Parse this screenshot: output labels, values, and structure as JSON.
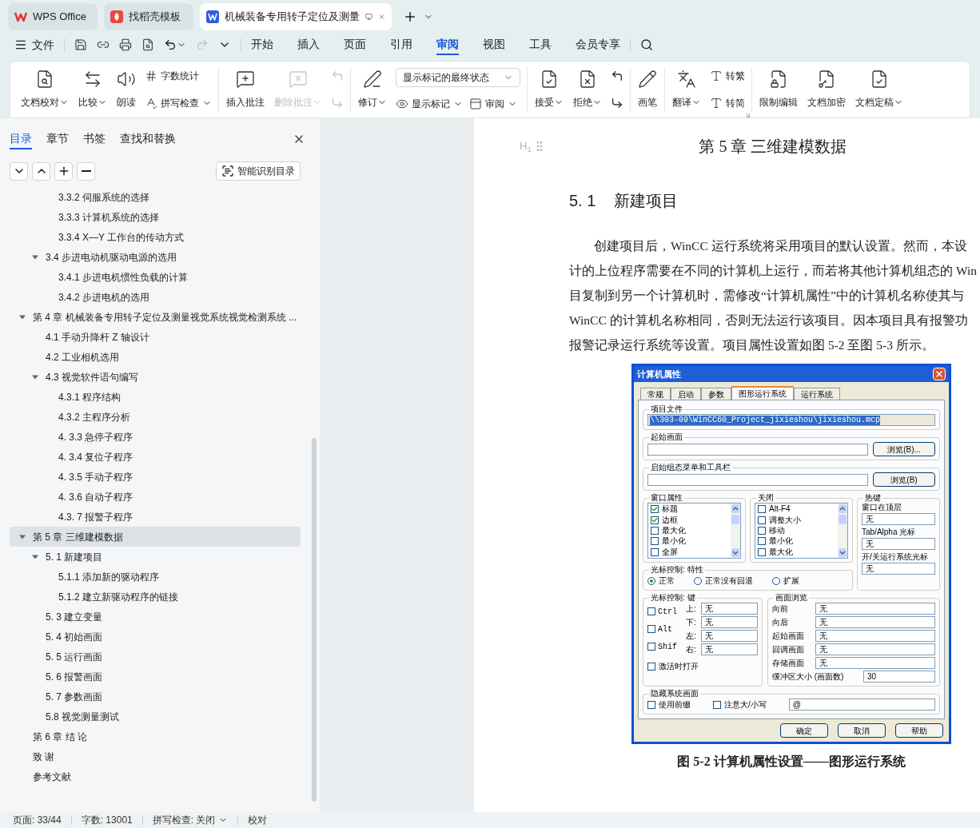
{
  "browser_tabs": [
    {
      "label": "WPS Office",
      "selected": false
    },
    {
      "label": "找稻壳模板",
      "selected": false
    },
    {
      "label": "机械装备专用转子定位及测量",
      "selected": true
    }
  ],
  "menu": {
    "file": "文件",
    "tabs": [
      {
        "label": "开始",
        "selected": false
      },
      {
        "label": "插入",
        "selected": false
      },
      {
        "label": "页面",
        "selected": false
      },
      {
        "label": "引用",
        "selected": false
      },
      {
        "label": "审阅",
        "selected": true
      },
      {
        "label": "视图",
        "selected": false
      },
      {
        "label": "工具",
        "selected": false
      },
      {
        "label": "会员专享",
        "selected": false
      }
    ]
  },
  "ribbon": {
    "groups": [
      {
        "items": [
          {
            "kind": "large",
            "label": "文档校对",
            "caret": true,
            "disabled": false
          },
          {
            "kind": "large",
            "label": "比较",
            "caret": true,
            "disabled": false
          },
          {
            "kind": "large",
            "label": "朗读",
            "caret": false,
            "disabled": false
          },
          {
            "kind": "stack",
            "rows": [
              {
                "label": "字数统计",
                "caret": false
              },
              {
                "label": "拼写检查",
                "caret": true
              }
            ]
          }
        ]
      },
      {
        "items": [
          {
            "kind": "large",
            "label": "插入批注",
            "caret": false,
            "disabled": false
          },
          {
            "kind": "large",
            "label": "删除批注",
            "caret": true,
            "disabled": true
          },
          {
            "kind": "icons",
            "disabled": true
          }
        ]
      },
      {
        "items": [
          {
            "kind": "large",
            "label": "修订",
            "caret": true,
            "disabled": false
          },
          {
            "kind": "select",
            "value": "显示标记的最终状态",
            "rows": [
              {
                "label": "显示标记",
                "caret": true
              },
              {
                "label": "审阅",
                "caret": true
              }
            ]
          }
        ]
      },
      {
        "items": [
          {
            "kind": "large",
            "label": "接受",
            "caret": true,
            "disabled": false
          },
          {
            "kind": "large",
            "label": "拒绝",
            "caret": true,
            "disabled": false
          },
          {
            "kind": "icons",
            "disabled": false
          }
        ]
      },
      {
        "items": [
          {
            "kind": "large",
            "label": "画笔",
            "caret": false,
            "disabled": false
          }
        ]
      },
      {
        "launcher": true,
        "items": [
          {
            "kind": "large",
            "label": "翻译",
            "caret": true,
            "disabled": false
          },
          {
            "kind": "stack",
            "rows": [
              {
                "label": "转繁",
                "caret": false
              },
              {
                "label": "转简",
                "caret": false
              }
            ]
          }
        ]
      },
      {
        "items": [
          {
            "kind": "large",
            "label": "限制编辑",
            "caret": false,
            "disabled": false
          },
          {
            "kind": "large",
            "label": "文档加密",
            "caret": false,
            "disabled": false
          },
          {
            "kind": "large",
            "label": "文档定稿",
            "caret": true,
            "disabled": false
          }
        ]
      }
    ]
  },
  "nav": {
    "tabs": [
      {
        "label": "目录",
        "selected": true
      },
      {
        "label": "章节",
        "selected": false
      },
      {
        "label": "书签",
        "selected": false
      },
      {
        "label": "查找和替换",
        "selected": false
      }
    ],
    "smart_toc_button": "智能识别目录",
    "toc": [
      {
        "children": [
          {
            "children": [
              {
                "label": "3.3.2 伺服系统的选择",
                "selected": false
              },
              {
                "label": "3.3.3 计算机系统的选择",
                "selected": false
              },
              {
                "label": "3.3.4 X—Y 工作台的传动方式",
                "selected": false
              }
            ]
          },
          {
            "label": "3.4 步进电动机驱动电源的选用",
            "selected": false,
            "expanded": true,
            "children": [
              {
                "label": "3.4.1 步进电机惯性负载的计算",
                "selected": false
              },
              {
                "label": "3.4.2 步进电机的选用",
                "selected": false
              }
            ]
          }
        ]
      },
      {
        "label": "第 4 章  机械装备专用转子定位及测量视觉系统视觉检测系统 ...",
        "selected": false,
        "expanded": true,
        "children": [
          {
            "label": "4.1  手动升降杆 Z 轴设计",
            "selected": false
          },
          {
            "label": "4.2  工业相机选用",
            "selected": false
          },
          {
            "label": "4.3  视觉软件语句编写",
            "selected": false,
            "expanded": true,
            "children": [
              {
                "label": "4.3.1  程序结构",
                "selected": false
              },
              {
                "label": "4.3.2  主程序分析",
                "selected": false
              },
              {
                "label": "4. 3.3  急停子程序",
                "selected": false
              },
              {
                "label": "4. 3.4  复位子程序",
                "selected": false
              },
              {
                "label": "4. 3.5  手动子程序",
                "selected": false
              },
              {
                "label": "4. 3.6  自动子程序",
                "selected": false
              },
              {
                "label": "4.3. 7  报警子程序",
                "selected": false
              }
            ]
          }
        ]
      },
      {
        "label": "第 5 章  三维建模数据",
        "selected": true,
        "expanded": true,
        "children": [
          {
            "label": "5. 1    新建项目",
            "selected": false,
            "expanded": true,
            "children": [
              {
                "label": "5.1.1  添加新的驱动程序",
                "selected": false
              },
              {
                "label": "5.1.2   建立新驱动程序的链接",
                "selected": false
              }
            ]
          },
          {
            "label": "5. 3     建立变量",
            "selected": false
          },
          {
            "label": "5. 4     初始画面",
            "selected": false
          },
          {
            "label": "5. 5     运行画面",
            "selected": false
          },
          {
            "label": "5. 6     报警画面",
            "selected": false
          },
          {
            "label": "5. 7     参数画面",
            "selected": false
          },
          {
            "label": "5.8     视觉测量测试",
            "selected": false
          }
        ]
      },
      {
        "label": "第 6 章  结     论",
        "selected": false
      },
      {
        "label": "致     谢",
        "selected": false
      },
      {
        "label": "参考文献",
        "selected": false
      }
    ]
  },
  "document": {
    "heading_marker": "H$_{1}$",
    "chapter_title": "第 5 章  三维建模数据",
    "section_title": "5. 1    新建项目",
    "paragraph_lines": [
      "创建项目后，WinCC 运行系统将采用项目的默认设置。然而，本设",
      "计的上位程序需要在不同的计算机上运行，而若将其他计算机组态的 Win",
      "目复制到另一个计算机时，需修改“计算机属性”中的计算机名称使其与",
      "WinCC 的计算机名称相同，否则无法运行该项目。因本项目具有报警功",
      "报警记录运行系统等设置。项目属性设置如图 5-2 至图 5-3 所示。"
    ],
    "dialog": {
      "title": "计算机属性",
      "tabs": [
        {
          "label": "常规",
          "selected": false
        },
        {
          "label": "启动",
          "selected": false
        },
        {
          "label": "参数",
          "selected": false
        },
        {
          "label": "图形运行系统",
          "selected": true
        },
        {
          "label": "运行系统",
          "selected": false
        }
      ],
      "project_file": {
        "label": "项目文件",
        "value": "\\\\303-09\\WinCC60_Project_jixieshou\\jixieshou.mcp"
      },
      "start_picture": {
        "label": "起始画面",
        "button": "浏览(B)..."
      },
      "start_menu": {
        "label": "启始组态菜单和工具栏",
        "button": "浏览(B)"
      },
      "window_attributes": {
        "label": "窗口属性",
        "items": [
          {
            "label": "标题",
            "checked": true
          },
          {
            "label": "边框",
            "checked": true
          },
          {
            "label": "最大化",
            "checked": false
          },
          {
            "label": "最小化",
            "checked": false
          },
          {
            "label": "全屏",
            "checked": false
          }
        ]
      },
      "close": {
        "label": "关闭",
        "items": [
          {
            "label": "Alt-F4",
            "checked": false
          },
          {
            "label": "调整大小",
            "checked": false
          },
          {
            "label": "移动",
            "checked": false
          },
          {
            "label": "最小化",
            "checked": false
          },
          {
            "label": "最大化",
            "checked": false
          }
        ]
      },
      "hotkeys": {
        "label": "热键",
        "fields": [
          {
            "label": "窗口在顶层",
            "value": "无"
          },
          {
            "label": "Tab/Alpha 光标",
            "value": "无"
          },
          {
            "label": "开/关运行系统光标",
            "value": "无"
          }
        ]
      },
      "cursor_mode": {
        "label": "光标控制: 特性",
        "options": [
          {
            "label": "正常",
            "selected": true
          },
          {
            "label": "正常没有回退",
            "selected": false
          },
          {
            "label": "扩展",
            "selected": false
          }
        ]
      },
      "cursor_keys": {
        "label": "光标控制: 键",
        "modifiers": [
          {
            "label": "Ctrl",
            "checked": false
          },
          {
            "label": "Alt",
            "checked": false
          },
          {
            "label": "Shif",
            "checked": false
          }
        ],
        "directions": [
          {
            "label": "上:",
            "value": "无"
          },
          {
            "label": "下:",
            "value": "无"
          },
          {
            "label": "左:",
            "value": "无"
          },
          {
            "label": "右:",
            "value": "无"
          }
        ],
        "activate": {
          "label": "激活时打开",
          "checked": false
        }
      },
      "picture_navigation": {
        "label": "画面浏览",
        "fields": [
          {
            "label": "向前",
            "value": "无"
          },
          {
            "label": "向后",
            "value": "无"
          },
          {
            "label": "起始画面",
            "value": "无"
          },
          {
            "label": "回调画面",
            "value": "无"
          },
          {
            "label": "存储画面",
            "value": "无"
          },
          {
            "label": "缓冲区大小 (画面数)",
            "value": "30"
          }
        ]
      },
      "hide_system": {
        "label": "隐藏系统画面",
        "options": [
          {
            "label": "使用前缀",
            "checked": false
          },
          {
            "label": "注意大/小写",
            "checked": false
          }
        ],
        "value": "@"
      },
      "buttons": [
        "确定",
        "取消",
        "帮助"
      ]
    },
    "caption": "图 5-2 计算机属性设置——图形运行系统"
  },
  "status_bar": [
    {
      "text": "页面: 33/44",
      "caret": false
    },
    {
      "text": "字数: 13001",
      "caret": false
    },
    {
      "text": "拼写检查: 关闭",
      "caret": true
    },
    {
      "text": "校对",
      "caret": false
    }
  ]
}
